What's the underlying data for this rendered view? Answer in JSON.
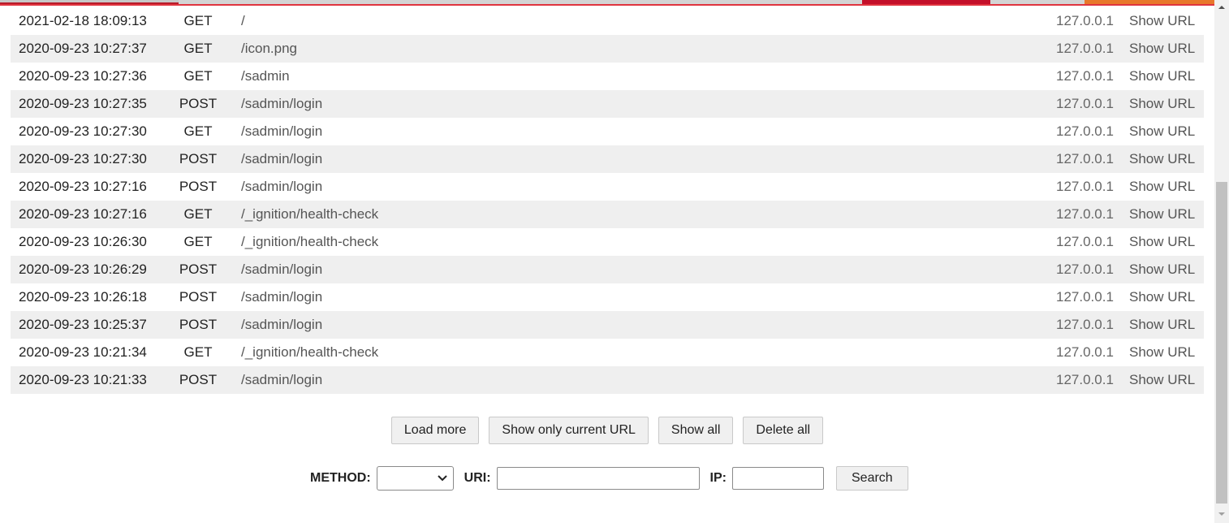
{
  "log": {
    "rows": [
      {
        "time": "2021-02-18 18:09:13",
        "method": "GET",
        "uri": "/",
        "ip": "127.0.0.1",
        "action": "Show URL"
      },
      {
        "time": "2020-09-23 10:27:37",
        "method": "GET",
        "uri": "/icon.png",
        "ip": "127.0.0.1",
        "action": "Show URL"
      },
      {
        "time": "2020-09-23 10:27:36",
        "method": "GET",
        "uri": "/sadmin",
        "ip": "127.0.0.1",
        "action": "Show URL"
      },
      {
        "time": "2020-09-23 10:27:35",
        "method": "POST",
        "uri": "/sadmin/login",
        "ip": "127.0.0.1",
        "action": "Show URL"
      },
      {
        "time": "2020-09-23 10:27:30",
        "method": "GET",
        "uri": "/sadmin/login",
        "ip": "127.0.0.1",
        "action": "Show URL"
      },
      {
        "time": "2020-09-23 10:27:30",
        "method": "POST",
        "uri": "/sadmin/login",
        "ip": "127.0.0.1",
        "action": "Show URL"
      },
      {
        "time": "2020-09-23 10:27:16",
        "method": "POST",
        "uri": "/sadmin/login",
        "ip": "127.0.0.1",
        "action": "Show URL"
      },
      {
        "time": "2020-09-23 10:27:16",
        "method": "GET",
        "uri": "/_ignition/health-check",
        "ip": "127.0.0.1",
        "action": "Show URL"
      },
      {
        "time": "2020-09-23 10:26:30",
        "method": "GET",
        "uri": "/_ignition/health-check",
        "ip": "127.0.0.1",
        "action": "Show URL"
      },
      {
        "time": "2020-09-23 10:26:29",
        "method": "POST",
        "uri": "/sadmin/login",
        "ip": "127.0.0.1",
        "action": "Show URL"
      },
      {
        "time": "2020-09-23 10:26:18",
        "method": "POST",
        "uri": "/sadmin/login",
        "ip": "127.0.0.1",
        "action": "Show URL"
      },
      {
        "time": "2020-09-23 10:25:37",
        "method": "POST",
        "uri": "/sadmin/login",
        "ip": "127.0.0.1",
        "action": "Show URL"
      },
      {
        "time": "2020-09-23 10:21:34",
        "method": "GET",
        "uri": "/_ignition/health-check",
        "ip": "127.0.0.1",
        "action": "Show URL"
      },
      {
        "time": "2020-09-23 10:21:33",
        "method": "POST",
        "uri": "/sadmin/login",
        "ip": "127.0.0.1",
        "action": "Show URL"
      }
    ]
  },
  "buttons": {
    "load_more": "Load more",
    "show_only_current": "Show only current URL",
    "show_all": "Show all",
    "delete_all": "Delete all"
  },
  "search": {
    "method_label": "METHOD:",
    "method_value": "",
    "uri_label": "URI:",
    "uri_value": "",
    "ip_label": "IP:",
    "ip_value": "",
    "search_button": "Search"
  },
  "icons": {
    "select_chevron": "chevron-down-icon",
    "scroll_up": "arrow-up-icon",
    "scroll_down": "arrow-down-icon"
  },
  "colors": {
    "accent_red": "#e0343f",
    "row_stripe": "#efefef",
    "button_bg": "#f0f0f0",
    "scrollbar_thumb": "#c1c1c1"
  }
}
